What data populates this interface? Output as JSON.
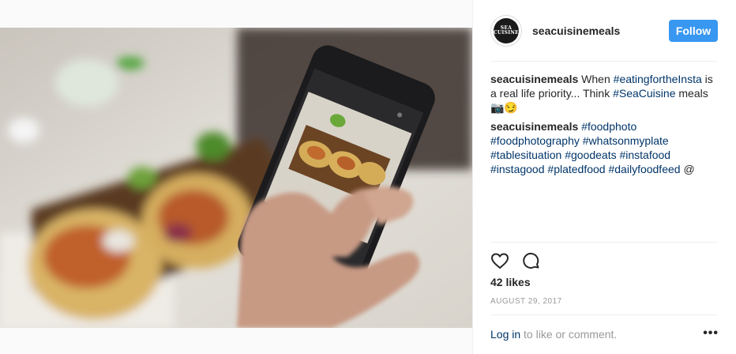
{
  "post": {
    "username": "seacuisinemeals",
    "avatar_text": [
      "SEA",
      "CUISINE"
    ],
    "follow_label": "Follow",
    "caption1": {
      "user": "seacuisinemeals",
      "t1": " When ",
      "tag1": "#eatingfortheInsta",
      "t2": " is a real life priority... Think ",
      "tag2": "#SeaCuisine",
      "t3": " meals 📷😏"
    },
    "caption2": {
      "user": "seacuisinemeals",
      "tags": [
        "#foodphoto",
        "#foodphotography",
        "#whatsonmyplate",
        "#tablesituation",
        "#goodeats",
        "#instafood",
        "#instagood",
        "#platedfood",
        "#dailyfoodfeed"
      ],
      "tail": "@"
    },
    "likes": "42 likes",
    "date": "AUGUST 29, 2017",
    "login_link": "Log in",
    "login_rest": " to like or comment.",
    "more": "•••"
  },
  "icons": {
    "like": "heart-outline-icon",
    "comment": "comment-bubble-icon"
  },
  "colors": {
    "follow_bg": "#3897f0",
    "hashtag": "#003569",
    "muted": "#999999"
  }
}
